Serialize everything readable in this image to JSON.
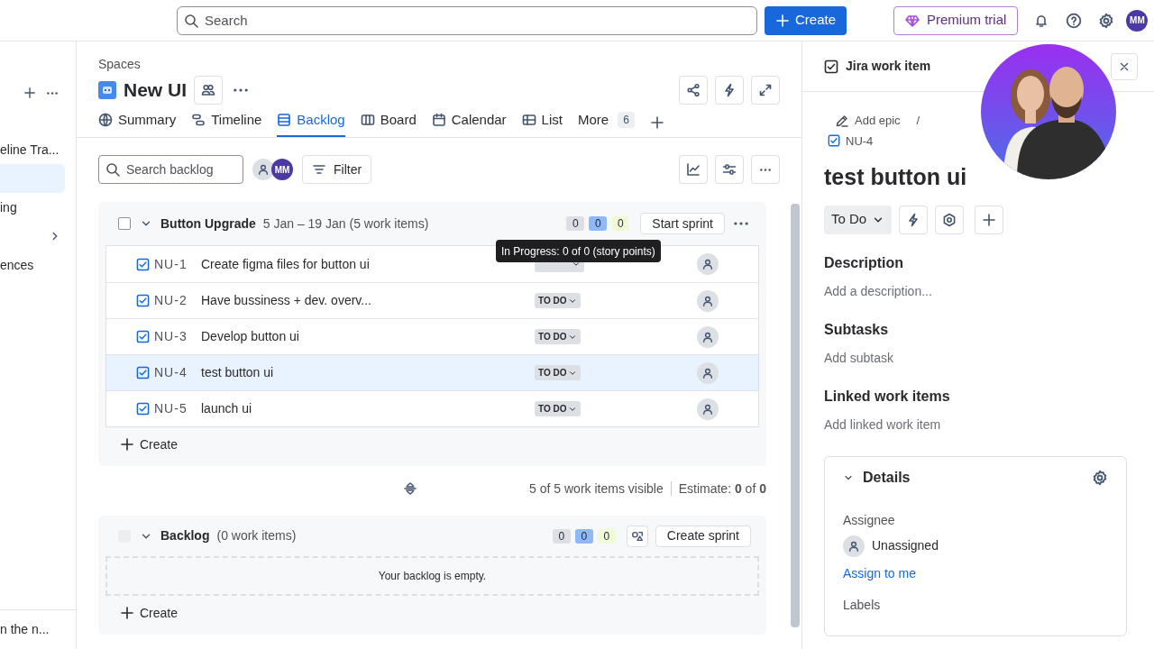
{
  "top_bar": {
    "search": {
      "placeholder": "Search"
    },
    "create": "Create",
    "premium": "Premium trial",
    "avatar": "MM"
  },
  "sidebar": {
    "items": [
      {
        "label": "eline Tra...",
        "selected": false
      },
      {
        "selected": true
      },
      {
        "label": "ing",
        "selected": false
      },
      {
        "selected": false,
        "expandable": true
      },
      {
        "label": "ences",
        "selected": false
      }
    ],
    "footer": "n the n..."
  },
  "space": {
    "breadcrumb": "Spaces",
    "title": "New UI"
  },
  "tabs": [
    {
      "label": "Summary",
      "selected": false
    },
    {
      "label": "Timeline",
      "selected": false
    },
    {
      "label": "Backlog",
      "selected": true
    },
    {
      "label": "Board",
      "selected": false
    },
    {
      "label": "Calendar",
      "selected": false
    },
    {
      "label": "List",
      "selected": false
    },
    {
      "label": "More",
      "count": "6",
      "selected": false
    }
  ],
  "toolbar": {
    "search": {
      "placeholder": "Search backlog"
    },
    "avatar": "MM",
    "filter": "Filter"
  },
  "sprint": {
    "checked": false,
    "name": "Button Upgrade",
    "dates": "5 Jan – 19 Jan (5 work items)",
    "counts": [
      {
        "value": "0",
        "color": "#dcdfe4"
      },
      {
        "value": "0",
        "color": "#8fb8f6"
      },
      {
        "value": "0",
        "color": "#effbd8"
      }
    ],
    "action": "Start sprint",
    "tooltip": "In Progress: 0 of 0 (story points)",
    "rows": [
      {
        "key": "NU-1",
        "summary": "Create figma files for button ui",
        "selected": false
      },
      {
        "key": "NU-2",
        "summary": "Have bussiness + dev. overv...",
        "status": "TO DO",
        "selected": false
      },
      {
        "key": "NU-3",
        "summary": "Develop button ui",
        "status": "TO DO",
        "selected": false
      },
      {
        "key": "NU-4",
        "summary": "test button ui",
        "status": "TO DO",
        "selected": true
      },
      {
        "key": "NU-5",
        "summary": "launch ui",
        "status": "TO DO",
        "selected": false
      }
    ],
    "create": "Create"
  },
  "summary_line": {
    "visible": "5 of 5 work items visible",
    "estimate": "Estimate: **0** of **0**"
  },
  "backlog": {
    "disabled": true,
    "name": "Backlog",
    "count": "(0 work items)",
    "counts": [
      {
        "value": "0",
        "color": "#dcdfe4"
      },
      {
        "value": "0",
        "color": "#8fb8f6"
      },
      {
        "value": "0",
        "color": "#effbd8"
      }
    ],
    "action": "Create sprint",
    "empty": "Your backlog is empty.",
    "create": "Create"
  },
  "detail": {
    "header": "Jira work item",
    "add_epic": "Add epic",
    "separator": "/",
    "key": "NU-4",
    "title": "test button ui",
    "status": "To Do",
    "sections": [
      {
        "heading": "Description",
        "hint": "Add a description..."
      },
      {
        "heading": "Subtasks",
        "hint": "Add subtask"
      },
      {
        "heading": "Linked work items",
        "hint": "Add linked work item"
      }
    ],
    "details": {
      "heading": "Details",
      "assignee_label": "Assignee",
      "assignee": "Unassigned",
      "assign_link": "Assign to me",
      "labels_label": "Labels"
    }
  }
}
